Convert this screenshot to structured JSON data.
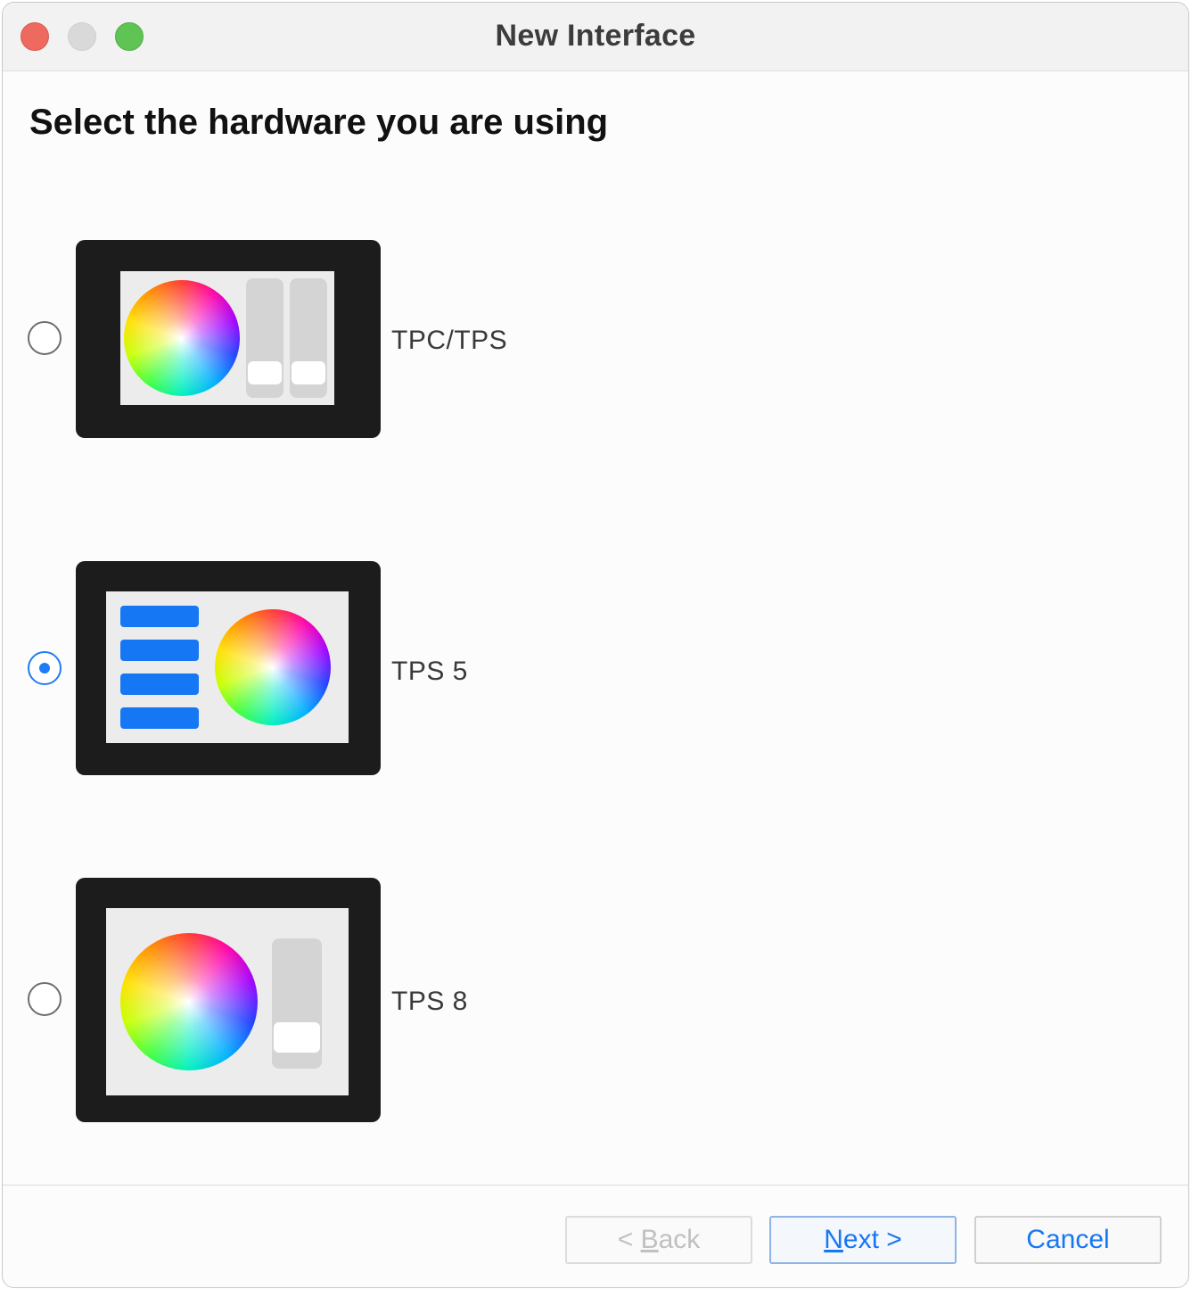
{
  "window": {
    "title": "New Interface",
    "traffic_lights": [
      "close",
      "minimize",
      "zoom"
    ]
  },
  "heading": "Select the hardware you are using",
  "options": [
    {
      "label": "TPC/TPS",
      "selected": false,
      "icon": "tpc-tps-device-icon"
    },
    {
      "label": "TPS 5",
      "selected": true,
      "icon": "tps5-device-icon"
    },
    {
      "label": "TPS 8",
      "selected": false,
      "icon": "tps8-device-icon"
    }
  ],
  "buttons": {
    "back": {
      "prefix": "< ",
      "mnemonic": "B",
      "rest": "ack",
      "enabled": false
    },
    "next": {
      "mnemonic": "N",
      "rest": "ext >",
      "enabled": true
    },
    "cancel": {
      "label": "Cancel",
      "enabled": true
    }
  },
  "colors": {
    "accent": "#1677f5",
    "close": "#ee6a5f",
    "minimize": "#d9d9d9",
    "zoom": "#5fc454",
    "device_frame": "#1c1c1c"
  }
}
